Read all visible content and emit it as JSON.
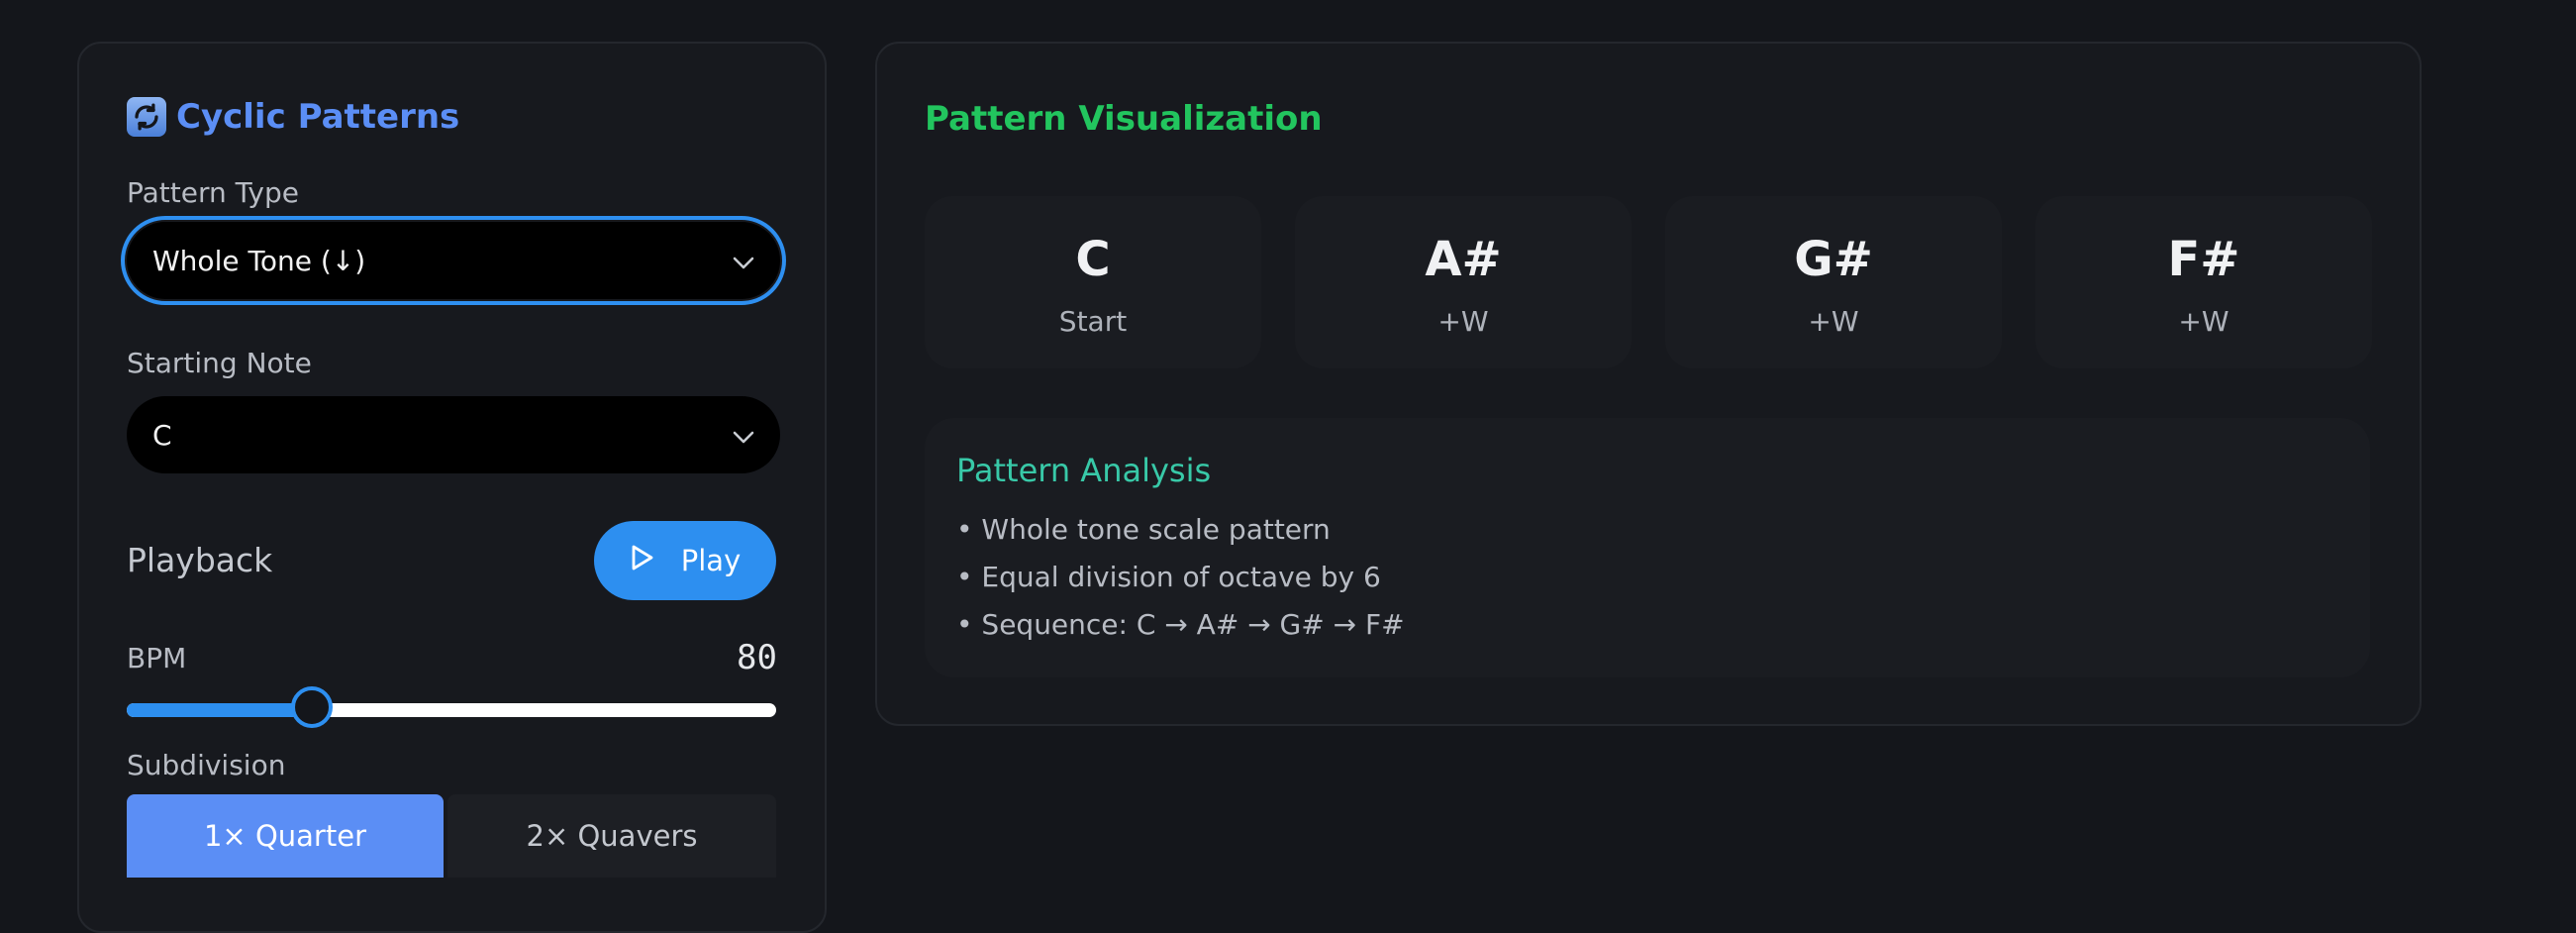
{
  "left_panel": {
    "title": "Cyclic Patterns",
    "title_icon": "refresh-icon",
    "pattern_type": {
      "label": "Pattern Type",
      "value": "Whole Tone (↓)"
    },
    "starting_note": {
      "label": "Starting Note",
      "value": "C"
    },
    "playback": {
      "label": "Playback",
      "play_label": "Play"
    },
    "bpm": {
      "label": "BPM",
      "value": "80",
      "slider_fraction": 0.285
    },
    "subdivision": {
      "label": "Subdivision",
      "options": [
        "1× Quarter",
        "2× Quavers"
      ],
      "selected": "1× Quarter"
    }
  },
  "right_panel": {
    "title": "Pattern Visualization",
    "notes": [
      {
        "name": "C",
        "step": "Start"
      },
      {
        "name": "A#",
        "step": "+W"
      },
      {
        "name": "G#",
        "step": "+W"
      },
      {
        "name": "F#",
        "step": "+W"
      }
    ],
    "analysis": {
      "title": "Pattern Analysis",
      "items": [
        "• Whole tone scale pattern",
        "• Equal division of octave by 6",
        "• Sequence: C → A# → G# → F#"
      ]
    }
  },
  "colors": {
    "background": "#14161b",
    "accent_blue": "#2d8ff0",
    "title_blue": "#5b8ef5",
    "title_green": "#22c55e",
    "analysis_teal": "#38c9a8"
  }
}
